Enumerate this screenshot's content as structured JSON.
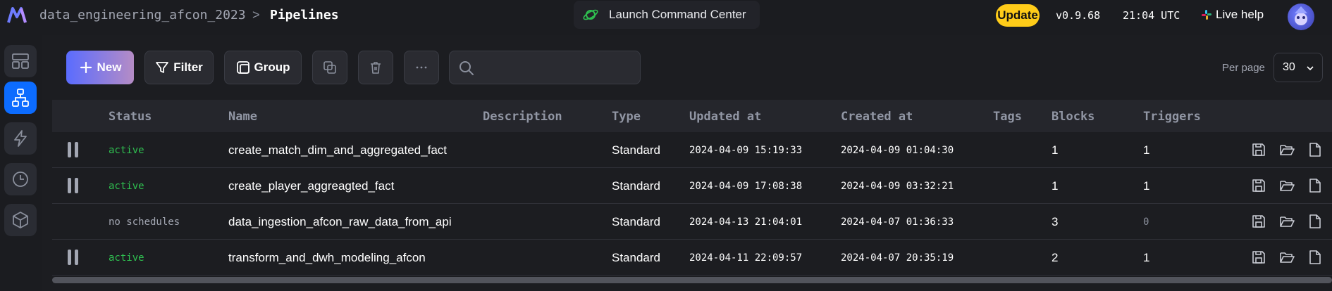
{
  "header": {
    "breadcrumb_project": "data_engineering_afcon_2023",
    "breadcrumb_separator": ">",
    "breadcrumb_current": "Pipelines",
    "launch_label": "Launch Command Center",
    "update_label": "Update",
    "version": "v0.9.68",
    "clock": "21:04 UTC",
    "live_help_label": "Live help",
    "colors": {
      "accent": "#0c6cff",
      "update": "#ffcc19",
      "active": "#2fbf50"
    }
  },
  "sidebar": {
    "items": [
      {
        "icon": "layout-icon",
        "active": false
      },
      {
        "icon": "pipeline-tree-icon",
        "active": true
      },
      {
        "icon": "lightning-icon",
        "active": false
      },
      {
        "icon": "clock-icon",
        "active": false
      },
      {
        "icon": "cube-icon",
        "active": false
      }
    ]
  },
  "toolbar": {
    "new_label": "New",
    "filter_label": "Filter",
    "group_label": "Group",
    "search_placeholder": "",
    "per_page_label": "Per page",
    "per_page_value": "30"
  },
  "table": {
    "headers": {
      "status": "Status",
      "name": "Name",
      "description": "Description",
      "type": "Type",
      "updated_at": "Updated at",
      "created_at": "Created at",
      "tags": "Tags",
      "blocks": "Blocks",
      "triggers": "Triggers"
    },
    "rows": [
      {
        "status": "active",
        "name": "create_match_dim_and_aggregated_fact",
        "description": "",
        "type": "Standard",
        "updated_at": "2024-04-09 15:19:33",
        "created_at": "2024-04-09 01:04:30",
        "tags": "",
        "blocks": "1",
        "triggers": "1"
      },
      {
        "status": "active",
        "name": "create_player_aggreagted_fact",
        "description": "",
        "type": "Standard",
        "updated_at": "2024-04-09 17:08:38",
        "created_at": "2024-04-09 03:32:21",
        "tags": "",
        "blocks": "1",
        "triggers": "1"
      },
      {
        "status": "no schedules",
        "name": "data_ingestion_afcon_raw_data_from_api",
        "description": "",
        "type": "Standard",
        "updated_at": "2024-04-13 21:04:01",
        "created_at": "2024-04-07 01:36:33",
        "tags": "",
        "blocks": "3",
        "triggers": "0"
      },
      {
        "status": "active",
        "name": "transform_and_dwh_modeling_afcon",
        "description": "",
        "type": "Standard",
        "updated_at": "2024-04-11 22:09:57",
        "created_at": "2024-04-07 20:35:19",
        "tags": "",
        "blocks": "2",
        "triggers": "1"
      }
    ]
  }
}
